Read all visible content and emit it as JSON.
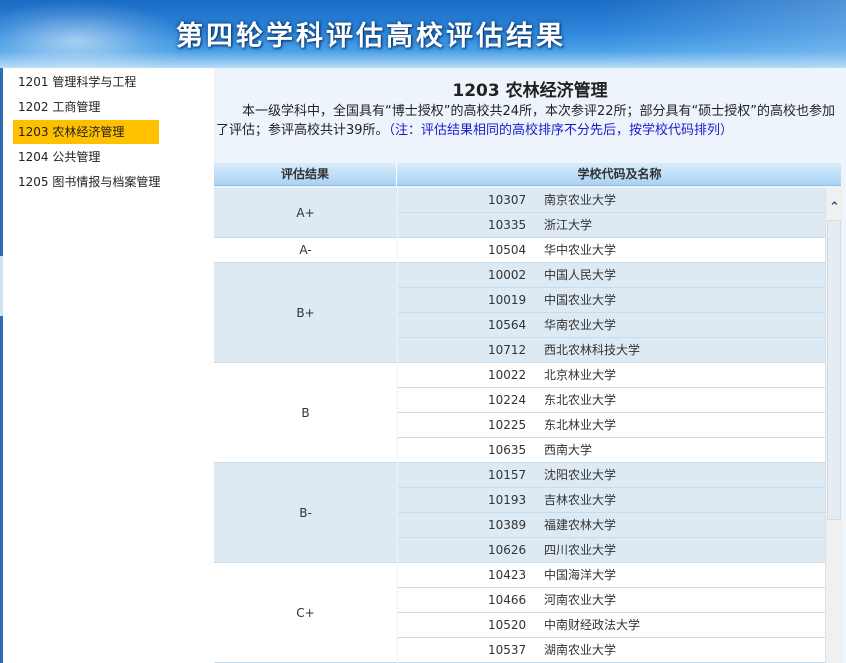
{
  "banner": {
    "title": "第四轮学科评估高校评估结果"
  },
  "sidebar": {
    "items": [
      {
        "label": "1201 管理科学与工程",
        "active": false
      },
      {
        "label": "1202 工商管理",
        "active": false
      },
      {
        "label": "1203 农林经济管理",
        "active": true
      },
      {
        "label": "1204 公共管理",
        "active": false
      },
      {
        "label": "1205 图书情报与档案管理",
        "active": false
      }
    ]
  },
  "main": {
    "heading": "1203 农林经济管理",
    "intro": "本一级学科中，全国具有“博士授权”的高校共24所，本次参评22所；部分具有“硕士授权”的高校也参加了评估；参评高校共计39所。",
    "note": "（注：评估结果相同的高校排序不分先后，按学校代码排列）",
    "table": {
      "headers": [
        "评估结果",
        "学校代码及名称"
      ],
      "groups": [
        {
          "grade": "A+",
          "schools": [
            {
              "code": "10307",
              "name": "南京农业大学"
            },
            {
              "code": "10335",
              "name": "浙江大学"
            }
          ]
        },
        {
          "grade": "A-",
          "schools": [
            {
              "code": "10504",
              "name": "华中农业大学"
            }
          ]
        },
        {
          "grade": "B+",
          "schools": [
            {
              "code": "10002",
              "name": "中国人民大学"
            },
            {
              "code": "10019",
              "name": "中国农业大学"
            },
            {
              "code": "10564",
              "name": "华南农业大学"
            },
            {
              "code": "10712",
              "name": "西北农林科技大学"
            }
          ]
        },
        {
          "grade": "B",
          "schools": [
            {
              "code": "10022",
              "name": "北京林业大学"
            },
            {
              "code": "10224",
              "name": "东北农业大学"
            },
            {
              "code": "10225",
              "name": "东北林业大学"
            },
            {
              "code": "10635",
              "name": "西南大学"
            }
          ]
        },
        {
          "grade": "B-",
          "schools": [
            {
              "code": "10157",
              "name": "沈阳农业大学"
            },
            {
              "code": "10193",
              "name": "吉林农业大学"
            },
            {
              "code": "10389",
              "name": "福建农林大学"
            },
            {
              "code": "10626",
              "name": "四川农业大学"
            }
          ]
        },
        {
          "grade": "C+",
          "schools": [
            {
              "code": "10423",
              "name": "中国海洋大学"
            },
            {
              "code": "10466",
              "name": "河南农业大学"
            },
            {
              "code": "10520",
              "name": "中南财经政法大学"
            },
            {
              "code": "10537",
              "name": "湖南农业大学"
            }
          ]
        }
      ]
    }
  },
  "scrollbar": {
    "up_glyph": "⌃"
  },
  "colors": {
    "active_nav": "#ffc000",
    "banner": "#2d85da",
    "note_text": "#1a1ad0",
    "shaded_row": "#dde9f3"
  }
}
